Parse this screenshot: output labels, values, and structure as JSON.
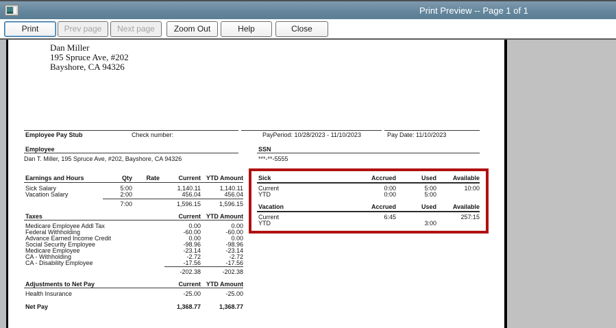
{
  "window": {
    "title": "Print Preview -- Page 1 of 1"
  },
  "toolbar": {
    "buttons": [
      {
        "label": "Print",
        "enabled": true
      },
      {
        "label": "Prev page",
        "enabled": false
      },
      {
        "label": "Next page",
        "enabled": false
      },
      {
        "label": "Zoom Out",
        "enabled": true
      },
      {
        "label": "Help",
        "enabled": true
      },
      {
        "label": "Close",
        "enabled": true
      }
    ]
  },
  "colors": {
    "titlebar_blue": "#64879d",
    "highlight_red": "#b11111",
    "preview_gray": "#c1c1c1",
    "disabled_text": "#a3a3a3"
  },
  "document": {
    "address": {
      "line1": "Dan Miller",
      "line2": "195 Spruce Ave, #202",
      "line3": "Bayshore, CA 94326"
    },
    "header": {
      "title": "Employee Pay Stub",
      "check_number_label": "Check number:",
      "pay_period": "PayPeriod: 10/28/2023 - 11/10/2023",
      "pay_date": "Pay Date: 11/10/2023"
    },
    "employee": {
      "label": "Employee",
      "value": "Dan T. Miller, 195 Spruce Ave, #202, Bayshore, CA 94326"
    },
    "ssn": {
      "label": "SSN",
      "value": "***-**-5555"
    },
    "cols": {
      "qty": "Qty",
      "rate": "Rate",
      "current": "Current",
      "ytd": "YTD Amount",
      "accrued": "Accrued",
      "used": "Used",
      "available": "Available"
    },
    "earnings": {
      "title": "Earnings and Hours",
      "rows": [
        {
          "label": "Sick Salary",
          "qty": "5:00",
          "rate": "",
          "current": "1,140.11",
          "ytd": "1,140.11"
        },
        {
          "label": "Vacation Salary",
          "qty": "2:00",
          "rate": "",
          "current": "456.04",
          "ytd": "456.04"
        }
      ],
      "total": {
        "qty": "7:00",
        "current": "1,596.15",
        "ytd": "1,596.15"
      }
    },
    "taxes": {
      "title": "Taxes",
      "rows": [
        {
          "label": "Medicare Employee Addl Tax",
          "current": "0.00",
          "ytd": "0.00"
        },
        {
          "label": "Federal Withholding",
          "current": "-60.00",
          "ytd": "-60.00"
        },
        {
          "label": "Advance Earned Income Credit",
          "current": "0.00",
          "ytd": "0.00"
        },
        {
          "label": "Social Security Employee",
          "current": "-98.96",
          "ytd": "-98.96"
        },
        {
          "label": "Medicare Employee",
          "current": "-23.14",
          "ytd": "-23.14"
        },
        {
          "label": "CA - Withholding",
          "current": "-2.72",
          "ytd": "-2.72"
        },
        {
          "label": "CA - Disability Employee",
          "current": "-17.56",
          "ytd": "-17.56"
        }
      ],
      "total": {
        "current": "-202.38",
        "ytd": "-202.38"
      }
    },
    "adjustments": {
      "title": "Adjustments to Net Pay",
      "rows": [
        {
          "label": "Health Insurance",
          "current": "-25.00",
          "ytd": "-25.00"
        }
      ]
    },
    "net_pay": {
      "label": "Net Pay",
      "current": "1,368.77",
      "ytd": "1,368.77"
    },
    "sick": {
      "title": "Sick",
      "rows": [
        {
          "label": "Current",
          "accrued": "0:00",
          "used": "5:00",
          "available": "10:00"
        },
        {
          "label": "YTD",
          "accrued": "0:00",
          "used": "5:00",
          "available": ""
        }
      ]
    },
    "vacation": {
      "title": "Vacation",
      "rows": [
        {
          "label": "Current",
          "accrued": "6:45",
          "used": "",
          "available": "257:15"
        },
        {
          "label": "YTD",
          "accrued": "",
          "used": "3:00",
          "available": ""
        }
      ]
    }
  }
}
